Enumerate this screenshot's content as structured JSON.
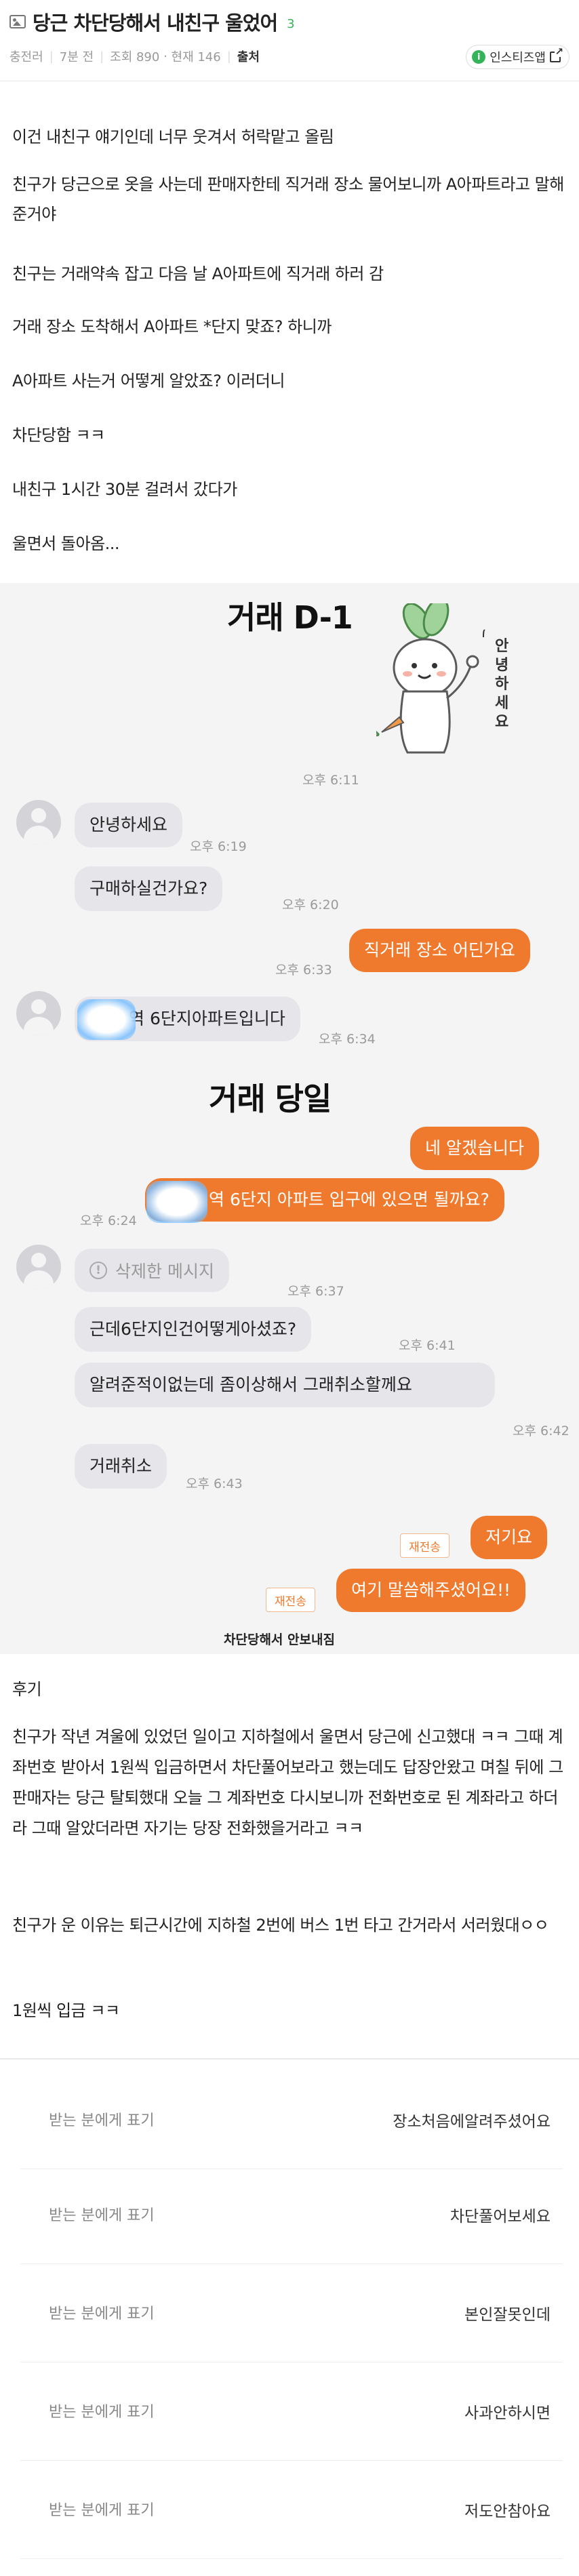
{
  "header": {
    "title": "당근 차단당해서 내친구 울었어",
    "comment_count": "3",
    "author": "충전러",
    "time_ago": "7분 전",
    "views": "조회 890",
    "current": "현재 146",
    "source_label": "출처",
    "app_button_label": "인스티즈앱",
    "app_logo_letter": "i"
  },
  "intro": [
    "이건 내친구 얘기인데 너무 웃겨서 허락맡고 올림",
    "친구가 당근으로 옷을 사는데 판매자한테 직거래 장소 물어보니까 A아파트라고 말해준거야",
    "친구는 거래약속 잡고 다음 날 A아파트에 직거래 하러 감",
    "거래 장소 도착해서 A아파트 *단지 맞죠? 하니까",
    "A아파트 사는거 어떻게 알았죠? 이러더니",
    "차단당함 ㅋㅋ",
    "내친구 1시간 30분 걸려서 갔다가",
    "울면서 돌아옴..."
  ],
  "chat": {
    "section1_title": "거래 D-1",
    "sticker_text": "안녕하세요",
    "m1_time": "오후 6:11",
    "m2_text": "안녕하세요",
    "m2_time": "오후 6:19",
    "m3_text": "구매하실건가요?",
    "m3_time": "오후 6:20",
    "m4_text": "직거래 장소 어딘가요",
    "m4_time": "오후 6:33",
    "m5_text": "역 6단지아파트입니다",
    "m5_time": "오후 6:34",
    "section2_title": "거래 당일",
    "m6_text": "네 알겠습니다",
    "m7_text": "역 6단지 아파트 입구에 있으면 될까요?",
    "m7_time": "오후 6:24",
    "m8_text": "삭제한 메시지",
    "m8_time": "오후 6:37",
    "m9_text": "근데6단지인건어떻게아셨죠?",
    "m9_time": "오후 6:41",
    "m10_text": "알려준적이없는데  좀이상해서 그래취소할께요",
    "m10_time": "오후 6:42",
    "m11_text": "거래취소",
    "m11_time": "오후 6:43",
    "resend_label": "재전송",
    "m12_text": "저기요",
    "m13_text": "여기 말씀해주셨어요!!",
    "blocked_text": "차단당해서 안보내짐"
  },
  "after": {
    "heading": "후기",
    "p1": "친구가 작년 겨울에 있었던 일이고 지하철에서 울면서 당근에 신고했대 ㅋㅋ 그때 계좌번호 받아서 1원씩 입금하면서 차단풀어보라고 했는데도 답장안왔고 며칠 뒤에 그 판매자는 당근 탈퇴했대 오늘 그 계좌번호 다시보니까 전화번호로 된 계좌라고 하더라 그때 알았더라면 자기는 당장 전화했을거라고 ㅋㅋ",
    "p2": "친구가 운 이유는 퇴근시간에 지하철 2번에 버스 1번 타고 간거라서 서러웠대ㅇㅇ",
    "p3": "1원씩 입금 ㅋㅋ"
  },
  "transfers": {
    "label": "받는 분에게 표기",
    "items": [
      "장소처음에알려주셨어요",
      "차단풀어보세요",
      "본인잘못인데",
      "사과안하시면",
      "저도안참아요"
    ]
  },
  "colors": {
    "accent_orange": "#ef7a2e",
    "brand_green": "#35b35b",
    "incoming_bubble": "#e6e6ea"
  }
}
